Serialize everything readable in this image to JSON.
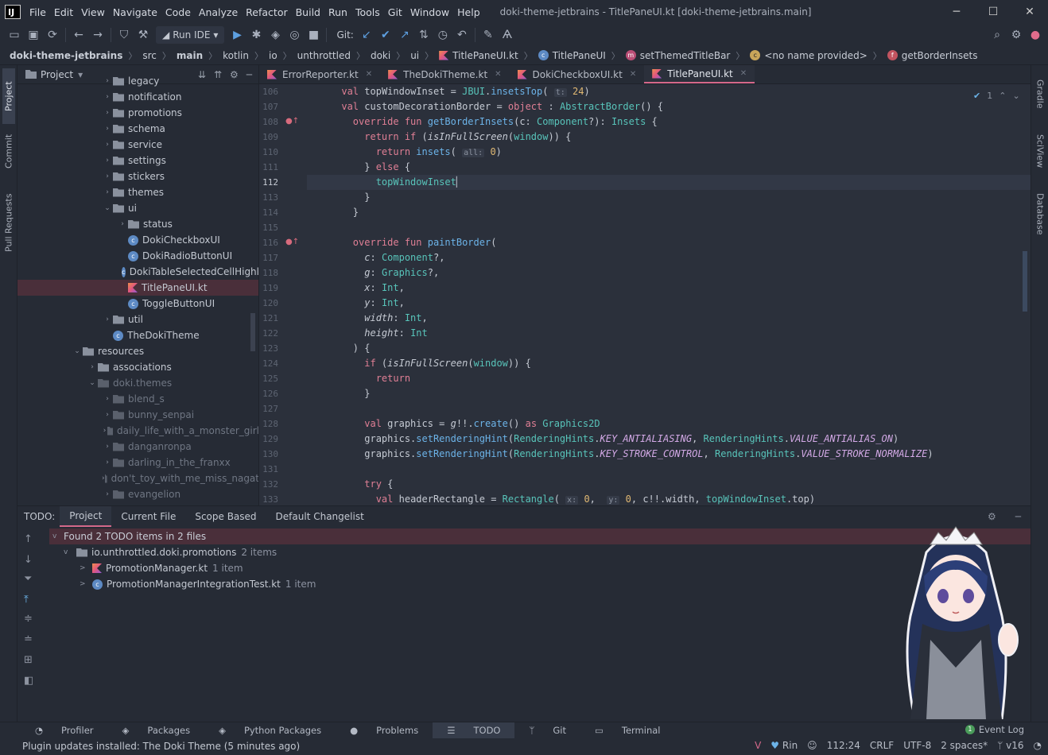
{
  "window": {
    "title": "doki-theme-jetbrains - TitlePaneUI.kt [doki-theme-jetbrains.main]",
    "menu": [
      "File",
      "Edit",
      "View",
      "Navigate",
      "Code",
      "Analyze",
      "Refactor",
      "Build",
      "Run",
      "Tools",
      "Git",
      "Window",
      "Help"
    ]
  },
  "toolbar": {
    "run_config": "Run IDE",
    "git_label": "Git:"
  },
  "breadcrumbs": [
    "doki-theme-jetbrains",
    "src",
    "main",
    "kotlin",
    "io",
    "unthrottled",
    "doki",
    "ui",
    "TitlePaneUI.kt",
    "TitlePaneUI",
    "setThemedTitleBar",
    "<no name provided>",
    "getBorderInsets"
  ],
  "left_tabs": [
    "Project",
    "Commit",
    "Pull Requests"
  ],
  "right_tabs": [
    "Gradle",
    "SciView",
    "Database"
  ],
  "project": {
    "header": "Project",
    "rows": [
      {
        "label": "legacy",
        "depth": 6,
        "type": "folder",
        "arrow": ">"
      },
      {
        "label": "notification",
        "depth": 6,
        "type": "folder",
        "arrow": ">"
      },
      {
        "label": "promotions",
        "depth": 6,
        "type": "folder",
        "arrow": ">"
      },
      {
        "label": "schema",
        "depth": 6,
        "type": "folder",
        "arrow": ">"
      },
      {
        "label": "service",
        "depth": 6,
        "type": "folder",
        "arrow": ">"
      },
      {
        "label": "settings",
        "depth": 6,
        "type": "folder",
        "arrow": ">"
      },
      {
        "label": "stickers",
        "depth": 6,
        "type": "folder",
        "arrow": ">"
      },
      {
        "label": "themes",
        "depth": 6,
        "type": "folder",
        "arrow": ">"
      },
      {
        "label": "ui",
        "depth": 6,
        "type": "folder",
        "arrow": "v"
      },
      {
        "label": "status",
        "depth": 7,
        "type": "folder",
        "arrow": ">"
      },
      {
        "label": "DokiCheckboxUI",
        "depth": 7,
        "type": "class",
        "arrow": ""
      },
      {
        "label": "DokiRadioButtonUI",
        "depth": 7,
        "type": "class",
        "arrow": ""
      },
      {
        "label": "DokiTableSelectedCellHighl",
        "depth": 7,
        "type": "class",
        "arrow": ""
      },
      {
        "label": "TitlePaneUI.kt",
        "depth": 7,
        "type": "kt",
        "arrow": "",
        "selected": true
      },
      {
        "label": "ToggleButtonUI",
        "depth": 7,
        "type": "class",
        "arrow": ""
      },
      {
        "label": "util",
        "depth": 6,
        "type": "folder",
        "arrow": ">"
      },
      {
        "label": "TheDokiTheme",
        "depth": 6,
        "type": "class",
        "arrow": ""
      },
      {
        "label": "resources",
        "depth": 4,
        "type": "folder",
        "arrow": "v"
      },
      {
        "label": "associations",
        "depth": 5,
        "type": "folder",
        "arrow": ">"
      },
      {
        "label": "doki.themes",
        "depth": 5,
        "type": "folder",
        "arrow": "v",
        "dim": true
      },
      {
        "label": "blend_s",
        "depth": 6,
        "type": "folder",
        "arrow": ">",
        "dim": true
      },
      {
        "label": "bunny_senpai",
        "depth": 6,
        "type": "folder",
        "arrow": ">",
        "dim": true
      },
      {
        "label": "daily_life_with_a_monster_girl",
        "depth": 6,
        "type": "folder",
        "arrow": ">",
        "dim": true
      },
      {
        "label": "danganronpa",
        "depth": 6,
        "type": "folder",
        "arrow": ">",
        "dim": true
      },
      {
        "label": "darling_in_the_franxx",
        "depth": 6,
        "type": "folder",
        "arrow": ">",
        "dim": true
      },
      {
        "label": "don't_toy_with_me_miss_nagat",
        "depth": 6,
        "type": "folder",
        "arrow": ">",
        "dim": true
      },
      {
        "label": "evangelion",
        "depth": 6,
        "type": "folder",
        "arrow": ">",
        "dim": true
      }
    ]
  },
  "editor": {
    "tabs": [
      {
        "label": "ErrorReporter.kt",
        "active": false
      },
      {
        "label": "TheDokiTheme.kt",
        "active": false
      },
      {
        "label": "DokiCheckboxUI.kt",
        "active": false
      },
      {
        "label": "TitlePaneUI.kt",
        "active": true
      }
    ],
    "inspection": "1",
    "first_line": 106,
    "current_line": 112,
    "override_markers": [
      108,
      116
    ]
  },
  "todo": {
    "label": "TODO:",
    "tabs": [
      "Project",
      "Current File",
      "Scope Based",
      "Default Changelist"
    ],
    "active_tab": "Project",
    "summary": "Found 2 TODO items in 2 files",
    "package": "io.unthrottled.doki.promotions",
    "package_count": "2 items",
    "files": [
      {
        "name": "PromotionManager.kt",
        "count": "1 item",
        "type": "kt"
      },
      {
        "name": "PromotionManagerIntegrationTest.kt",
        "count": "1 item",
        "type": "class"
      }
    ]
  },
  "statusbar": {
    "tool_windows": [
      "Profiler",
      "Packages",
      "Python Packages",
      "Problems",
      "TODO",
      "Git",
      "Terminal"
    ],
    "active_tool": "TODO",
    "event_log": "Event Log",
    "event_count": "1",
    "message": "Plugin updates installed: The Doki Theme (5 minutes ago)",
    "right": [
      "Rin",
      "112:24",
      "CRLF",
      "UTF-8",
      "2 spaces*",
      "v16"
    ]
  }
}
